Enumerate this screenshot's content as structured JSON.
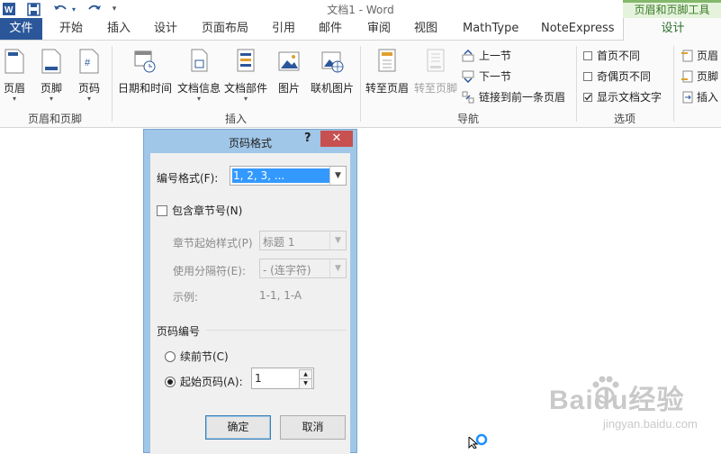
{
  "window": {
    "title": "文档1 - Word",
    "context_tools": "页眉和页脚工具"
  },
  "tabs": [
    {
      "label": "文件"
    },
    {
      "label": "开始"
    },
    {
      "label": "插入"
    },
    {
      "label": "设计"
    },
    {
      "label": "页面布局"
    },
    {
      "label": "引用"
    },
    {
      "label": "邮件"
    },
    {
      "label": "审阅"
    },
    {
      "label": "视图"
    },
    {
      "label": "MathType"
    },
    {
      "label": "NoteExpress"
    },
    {
      "label": "设计"
    }
  ],
  "ribbon": {
    "group_header_footer": {
      "label": "页眉和页脚",
      "header": "页眉",
      "footer": "页脚",
      "page_number": "页码"
    },
    "group_insert": {
      "label": "插入",
      "date_time": "日期和时间",
      "doc_info": "文档信息",
      "doc_parts": "文档部件",
      "picture": "图片",
      "online_picture": "联机图片"
    },
    "group_navigation": {
      "label": "导航",
      "goto_header": "转至页眉",
      "goto_footer": "转至页脚",
      "previous": "上一节",
      "next": "下一节",
      "link_previous": "链接到前一条页眉"
    },
    "group_options": {
      "label": "选项",
      "different_first": "首页不同",
      "different_odd_even": "奇偶页不同",
      "show_doc_text": "显示文档文字"
    },
    "group_position": {
      "header_top": "页眉",
      "footer_bottom": "页脚",
      "insert_tab": "插入"
    }
  },
  "dialog": {
    "title": "页码格式",
    "help": "?",
    "close": "✕",
    "number_format_label": "编号格式(F):",
    "number_format_value": "1, 2, 3, ...",
    "include_chapter": "包含章节号(N)",
    "chapter_style_label": "章节起始样式(P)",
    "chapter_style_value": "标题 1",
    "separator_label": "使用分隔符(E):",
    "separator_value": "-  (连字符)",
    "example_label": "示例:",
    "example_value": "1-1, 1-A",
    "page_numbering_label": "页码编号",
    "continue_label": "续前节(C)",
    "start_at_label": "起始页码(A):",
    "start_at_value": "1",
    "ok": "确定",
    "cancel": "取消"
  },
  "watermark": {
    "brand": "Baidu经验",
    "url": "jingyan.baidu.com"
  },
  "colors": {
    "word_blue": "#2b579a",
    "context_green": "#83b86c",
    "dialog_frame": "#a0c6e8",
    "close_red": "#c75050",
    "selection": "#3399ff"
  }
}
